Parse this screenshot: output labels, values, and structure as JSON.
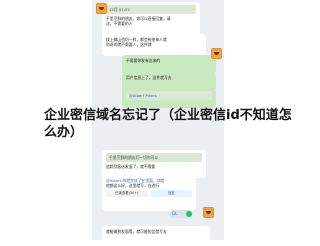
{
  "chat": {
    "messages": [
      {
        "id": "m1",
        "quote_name": "12月 01:07",
        "time": "",
        "lines": [
          "千里烹鲜的朋友，你可以直接回复，请",
          "法，不需要的人"
        ]
      },
      {
        "id": "m2",
        "quote_name": "",
        "time": "",
        "lines": [
          "找上佛山也切一样，都会有他来人就",
          "你说的就不需要人，这件就"
        ]
      },
      {
        "id": "m3",
        "quote_name": "",
        "time": "",
        "lines": [
          "不需要你发有出来的"
        ]
      },
      {
        "id": "m4",
        "quote_name": "",
        "time": "",
        "lines": [
          "用户信息上了，这件就写去"
        ]
      },
      {
        "id": "m5",
        "quote_name": "@Albert Pikers",
        "time": "",
        "lines": [
          "@Albert Pikers 这就能够对方",
          "学，看这样的事对上就写回"
        ]
      },
      {
        "id": "m6",
        "quote_name": "",
        "time": "",
        "lines": [
          "千里烹鲜的朋友们一切你可以",
          "追踪别客送发面了，就不需要"
        ]
      },
      {
        "id": "m7",
        "quote_name": "@Albert",
        "time": "",
        "lines": [
          "@Albert 的就完成了在里面，你就",
          "他都这么好，这里就写，在进行"
        ]
      },
      {
        "id": "m8",
        "quote_name": "",
        "time": "",
        "lines": [
          "就能做到发面等，就可能的比就写去"
        ]
      }
    ],
    "mini_buttons": [
      "已读查看(50+)",
      "回复"
    ],
    "toggle_text": "GL"
  },
  "overlay": {
    "title": "企业密信域名忘记了（企业密信id不知道怎么办）"
  }
}
